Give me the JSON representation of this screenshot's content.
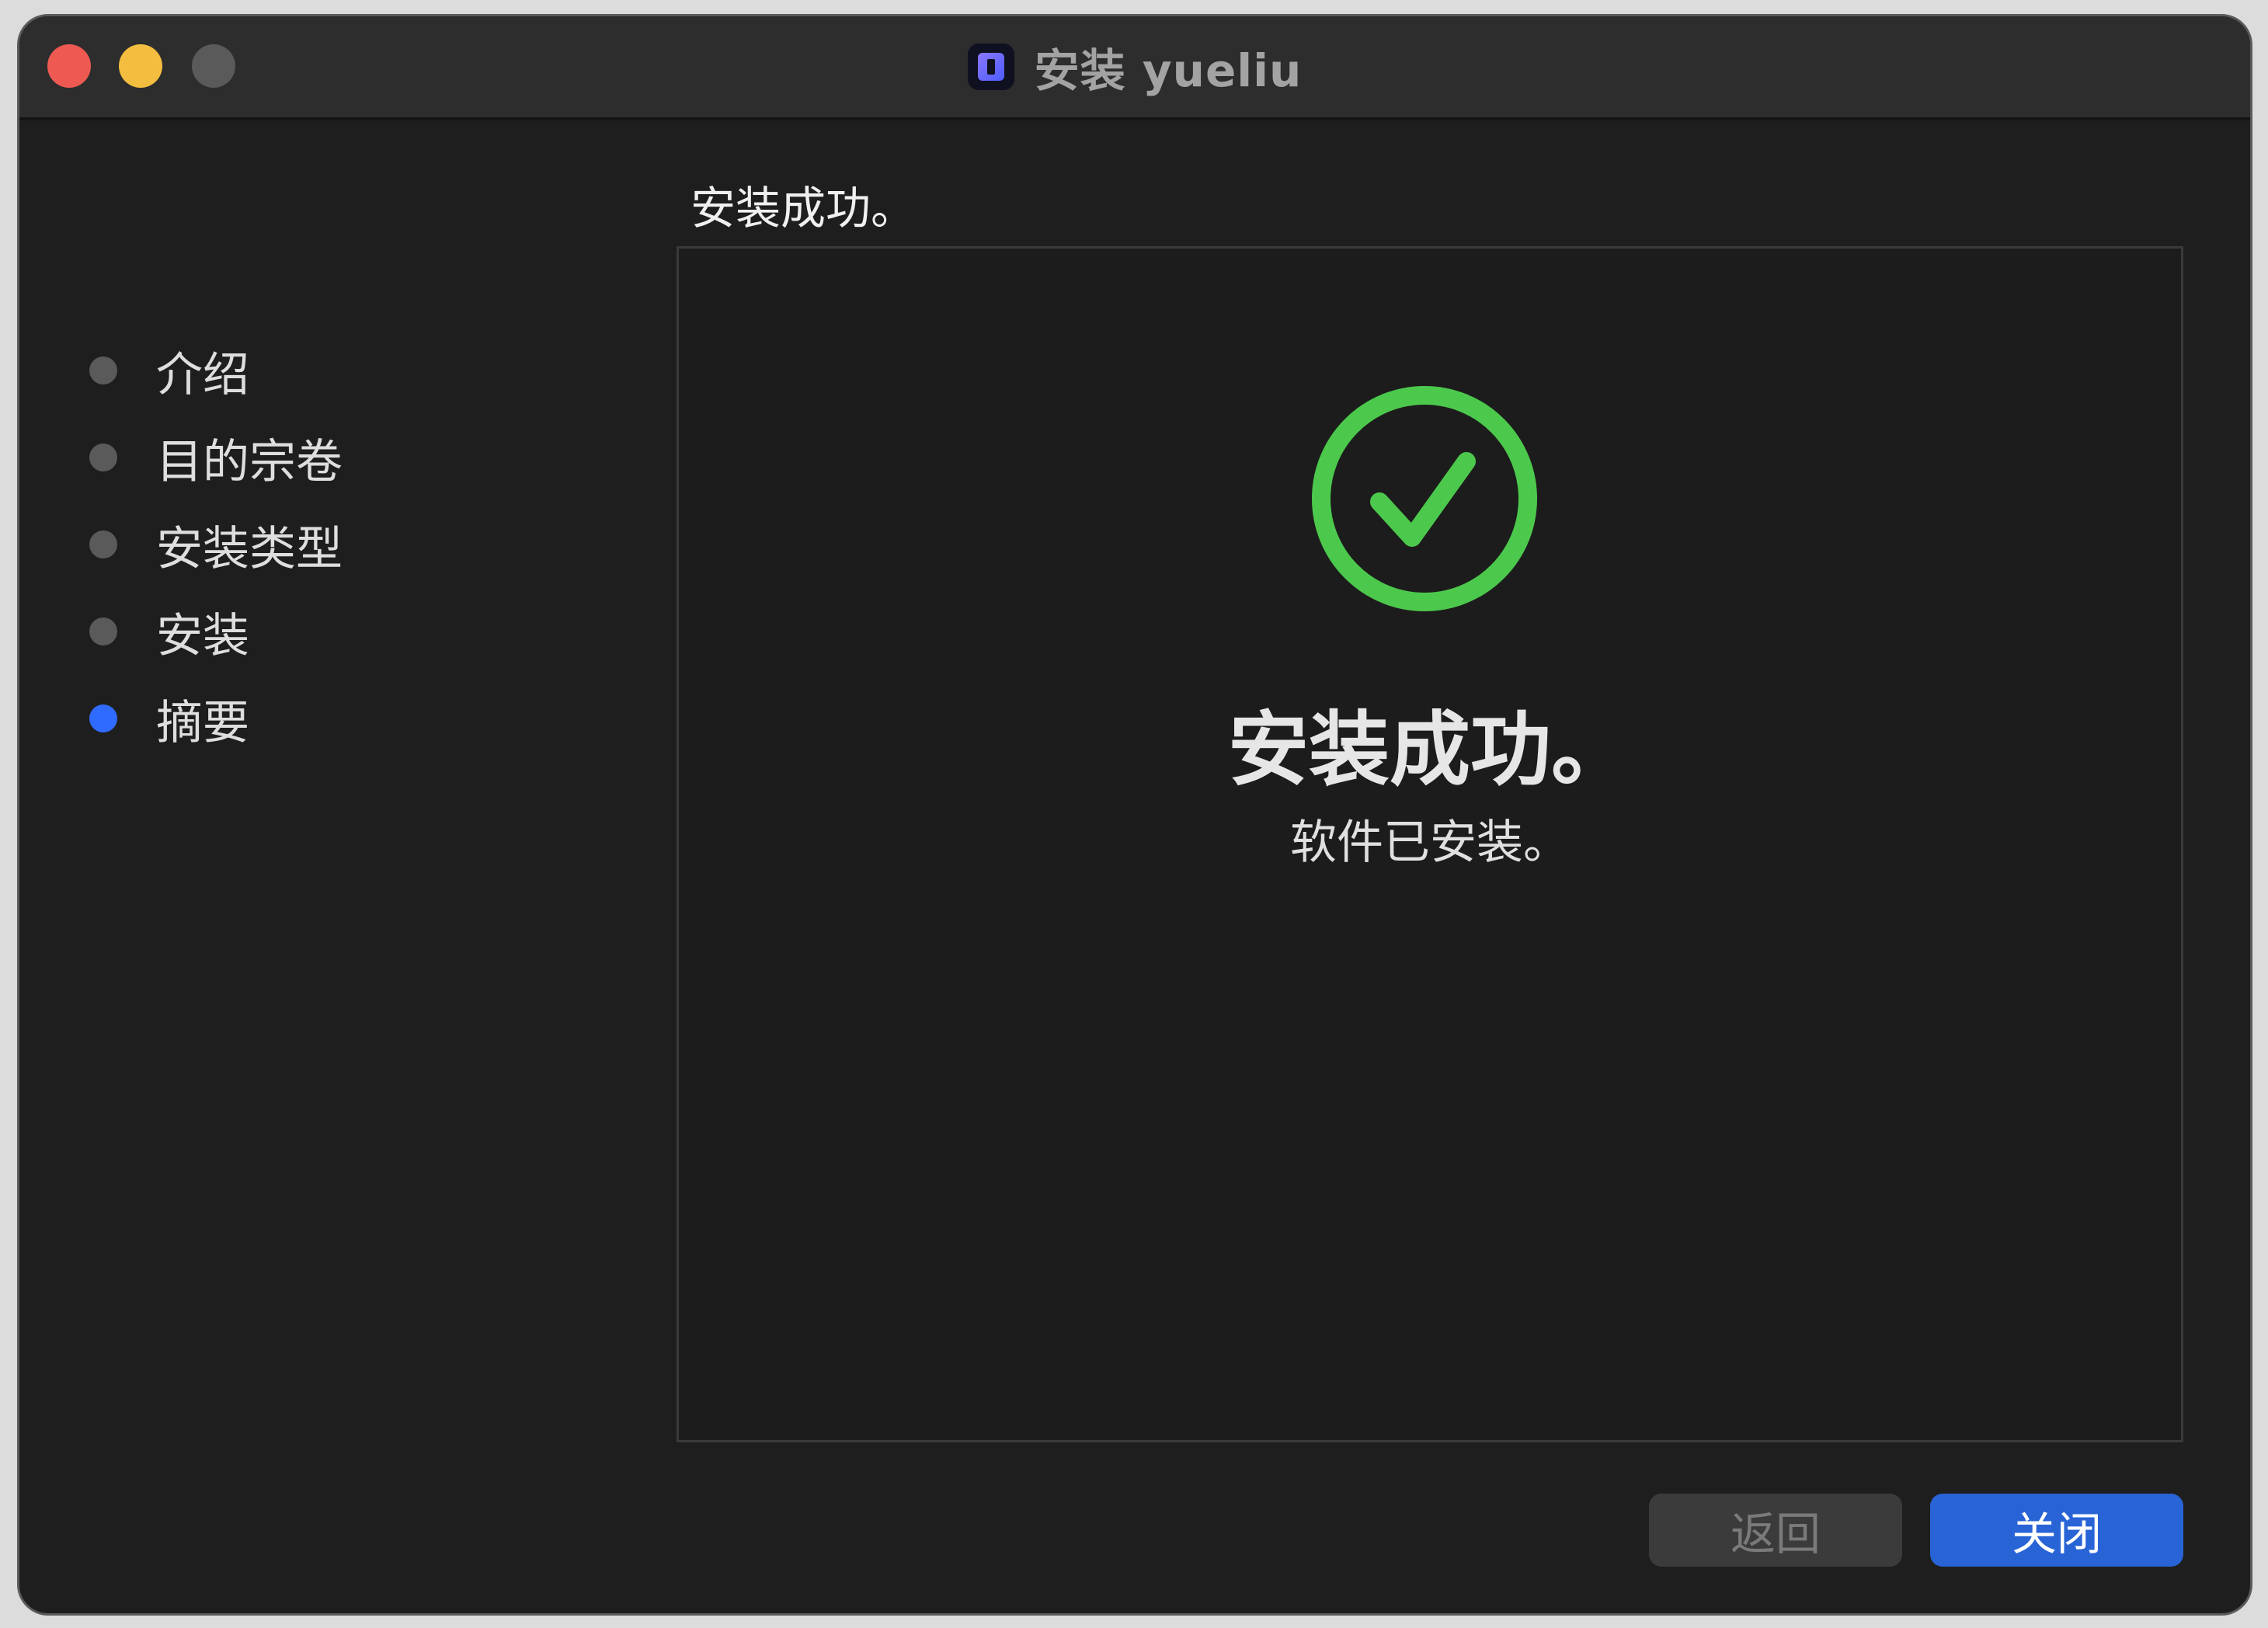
{
  "window": {
    "title": "安装 yueliu",
    "icon": "yueliu-app-icon"
  },
  "steps": [
    {
      "label": "介绍",
      "active": false
    },
    {
      "label": "目的宗卷",
      "active": false
    },
    {
      "label": "安装类型",
      "active": false
    },
    {
      "label": "安装",
      "active": false
    },
    {
      "label": "摘要",
      "active": true
    }
  ],
  "main": {
    "heading": "安装成功。",
    "result_title": "安装成功。",
    "result_subtitle": "软件已安装。"
  },
  "buttons": {
    "back_label": "返回",
    "close_label": "关闭"
  },
  "colors": {
    "success": "#4cc94c",
    "accent": "#2864d6",
    "active_step": "#2f6bff"
  }
}
